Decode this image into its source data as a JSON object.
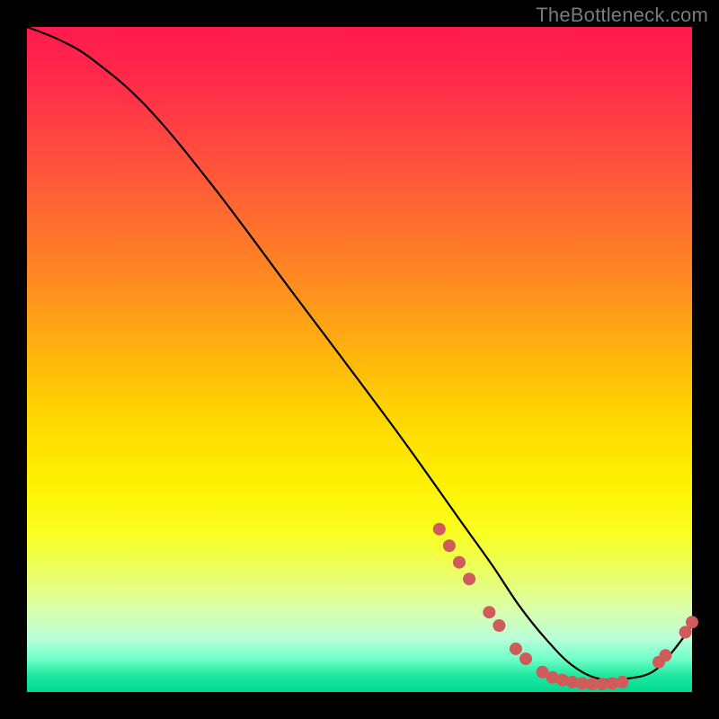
{
  "watermark": "TheBottleneck.com",
  "chart_data": {
    "type": "line",
    "title": "",
    "xlabel": "",
    "ylabel": "",
    "xlim": [
      0,
      100
    ],
    "ylim": [
      0,
      100
    ],
    "grid": false,
    "legend": false,
    "curve": {
      "x": [
        0,
        5,
        10,
        18,
        28,
        40,
        55,
        65,
        70,
        74,
        78,
        82,
        86,
        90,
        94,
        97,
        100
      ],
      "y": [
        100,
        98,
        95,
        88,
        76,
        60,
        40,
        26,
        19,
        13,
        8,
        4,
        2,
        2,
        3,
        6,
        10
      ]
    },
    "markers": [
      {
        "x": 62.0,
        "y": 24.5
      },
      {
        "x": 63.5,
        "y": 22.0
      },
      {
        "x": 65.0,
        "y": 19.5
      },
      {
        "x": 66.5,
        "y": 17.0
      },
      {
        "x": 69.5,
        "y": 12.0
      },
      {
        "x": 71.0,
        "y": 10.0
      },
      {
        "x": 73.5,
        "y": 6.5
      },
      {
        "x": 75.0,
        "y": 5.0
      },
      {
        "x": 77.5,
        "y": 3.0
      },
      {
        "x": 79.0,
        "y": 2.2
      },
      {
        "x": 80.5,
        "y": 1.8
      },
      {
        "x": 82.0,
        "y": 1.5
      },
      {
        "x": 83.5,
        "y": 1.3
      },
      {
        "x": 85.0,
        "y": 1.2
      },
      {
        "x": 86.5,
        "y": 1.2
      },
      {
        "x": 88.0,
        "y": 1.3
      },
      {
        "x": 89.5,
        "y": 1.5
      },
      {
        "x": 95.0,
        "y": 4.5
      },
      {
        "x": 96.0,
        "y": 5.5
      },
      {
        "x": 99.0,
        "y": 9.0
      },
      {
        "x": 100.0,
        "y": 10.5
      }
    ],
    "colors": {
      "curve": "#000000",
      "marker_fill": "#cf5b5b",
      "marker_stroke": "#cf5b5b"
    }
  }
}
